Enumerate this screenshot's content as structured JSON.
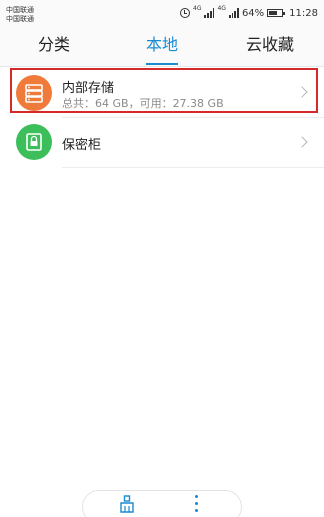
{
  "status_bar": {
    "carrier_1": "中国联通",
    "carrier_2": "中国联通",
    "net_tag_1": "4G",
    "net_tag_2": "4G",
    "battery_percent": "64%",
    "time": "11:28",
    "icons": [
      "alarm-icon",
      "signal-icon",
      "signal-icon",
      "battery-icon"
    ]
  },
  "tabs": [
    {
      "label": "分类",
      "active": false
    },
    {
      "label": "本地",
      "active": true
    },
    {
      "label": "云收藏",
      "active": false
    }
  ],
  "list": [
    {
      "title": "内部存储",
      "subtitle": "总共：64 GB，可用：27.38 GB",
      "icon": "storage-icon",
      "icon_color": "#f07a3a",
      "highlighted": true
    },
    {
      "title": "保密柜",
      "subtitle": "",
      "icon": "safe-icon",
      "icon_color": "#3cbf5a",
      "highlighted": false
    }
  ],
  "toolbar": {
    "icons": [
      "clean-icon",
      "more-icon"
    ],
    "accent": "#1a8ad1"
  },
  "colors": {
    "accent": "#1a8ad1",
    "highlight_border": "#d42a2a"
  }
}
